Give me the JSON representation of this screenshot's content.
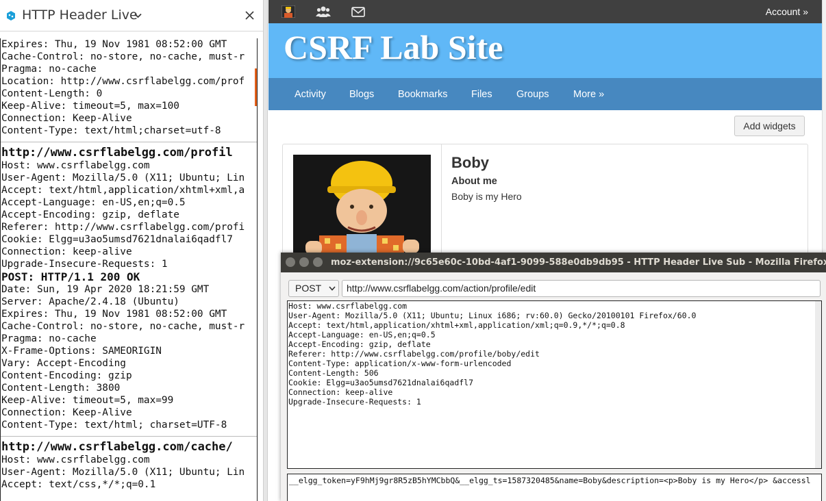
{
  "sidebar": {
    "title": "HTTP Header Live",
    "log": [
      {
        "cls": "",
        "text": "Expires: Thu, 19 Nov 1981 08:52:00 GMT"
      },
      {
        "cls": "",
        "text": "Cache-Control: no-store, no-cache, must-r"
      },
      {
        "cls": "",
        "text": "Pragma: no-cache"
      },
      {
        "cls": "",
        "text": "Location: http://www.csrflabelgg.com/prof"
      },
      {
        "cls": "",
        "text": "Content-Length: 0"
      },
      {
        "cls": "",
        "text": "Keep-Alive: timeout=5, max=100"
      },
      {
        "cls": "",
        "text": "Connection: Keep-Alive"
      },
      {
        "cls": "endblk",
        "text": "Content-Type: text/html;charset=utf-8"
      },
      {
        "cls": "url",
        "text": "http://www.csrflabelgg.com/profil"
      },
      {
        "cls": "",
        "text": "Host: www.csrflabelgg.com"
      },
      {
        "cls": "",
        "text": "User-Agent: Mozilla/5.0 (X11; Ubuntu; Lin"
      },
      {
        "cls": "",
        "text": "Accept: text/html,application/xhtml+xml,a"
      },
      {
        "cls": "",
        "text": "Accept-Language: en-US,en;q=0.5"
      },
      {
        "cls": "",
        "text": "Accept-Encoding: gzip, deflate"
      },
      {
        "cls": "",
        "text": "Referer: http://www.csrflabelgg.com/profi"
      },
      {
        "cls": "",
        "text": "Cookie: Elgg=u3ao5umsd7621dnalai6qadfl7"
      },
      {
        "cls": "",
        "text": "Connection: keep-alive"
      },
      {
        "cls": "",
        "text": "Upgrade-Insecure-Requests: 1"
      },
      {
        "cls": "stat",
        "text": "POST: HTTP/1.1 200 OK"
      },
      {
        "cls": "",
        "text": "Date: Sun, 19 Apr 2020 18:21:59 GMT"
      },
      {
        "cls": "",
        "text": "Server: Apache/2.4.18 (Ubuntu)"
      },
      {
        "cls": "",
        "text": "Expires: Thu, 19 Nov 1981 08:52:00 GMT"
      },
      {
        "cls": "",
        "text": "Cache-Control: no-store, no-cache, must-r"
      },
      {
        "cls": "",
        "text": "Pragma: no-cache"
      },
      {
        "cls": "",
        "text": "X-Frame-Options: SAMEORIGIN"
      },
      {
        "cls": "",
        "text": "Vary: Accept-Encoding"
      },
      {
        "cls": "",
        "text": "Content-Encoding: gzip"
      },
      {
        "cls": "",
        "text": "Content-Length: 3800"
      },
      {
        "cls": "",
        "text": "Keep-Alive: timeout=5, max=99"
      },
      {
        "cls": "",
        "text": "Connection: Keep-Alive"
      },
      {
        "cls": "endblk",
        "text": "Content-Type: text/html; charset=UTF-8"
      },
      {
        "cls": "url",
        "text": "http://www.csrflabelgg.com/cache/"
      },
      {
        "cls": "",
        "text": "Host: www.csrflabelgg.com"
      },
      {
        "cls": "",
        "text": "User-Agent: Mozilla/5.0 (X11; Ubuntu; Lin"
      },
      {
        "cls": "",
        "text": "Accept: text/css,*/*;q=0.1"
      }
    ]
  },
  "topbar": {
    "icons": [
      "avatar-icon",
      "users-icon",
      "mail-icon"
    ],
    "account": "Account »"
  },
  "site": {
    "title": "CSRF Lab Site",
    "nav": [
      "Activity",
      "Blogs",
      "Bookmarks",
      "Files",
      "Groups",
      "More »"
    ],
    "add_widgets": "Add widgets"
  },
  "profile": {
    "name": "Boby",
    "about_label": "About me",
    "about_text": "Boby is my Hero"
  },
  "subwindow": {
    "title": "moz-extension://9c65e60c-10bd-4af1-9099-588e0db9db95 - HTTP Header Live Sub - Mozilla Firefox",
    "method": "POST",
    "url": "http://www.csrflabelgg.com/action/profile/edit",
    "headers": [
      "Host: www.csrflabelgg.com",
      "User-Agent: Mozilla/5.0 (X11; Ubuntu; Linux i686; rv:60.0) Gecko/20100101 Firefox/60.0",
      "Accept: text/html,application/xhtml+xml,application/xml;q=0.9,*/*;q=0.8",
      "Accept-Language: en-US,en;q=0.5",
      "Accept-Encoding: gzip, deflate",
      "Referer: http://www.csrflabelgg.com/profile/boby/edit",
      "Content-Type: application/x-www-form-urlencoded",
      "Content-Length: 506",
      "Cookie: Elgg=u3ao5umsd7621dnalai6qadfl7",
      "Connection: keep-alive",
      "Upgrade-Insecure-Requests: 1"
    ],
    "body": "__elgg_token=yF9hMj9gr8R5zB5hYMCbbQ&__elgg_ts=1587320485&name=Boby&description=<p>Boby is my Hero</p> &accessl"
  },
  "colors": {
    "topbar": "#404040",
    "banner": "#60b8f7",
    "navbar": "#4788c0",
    "titlebar": "#3c3b37"
  }
}
